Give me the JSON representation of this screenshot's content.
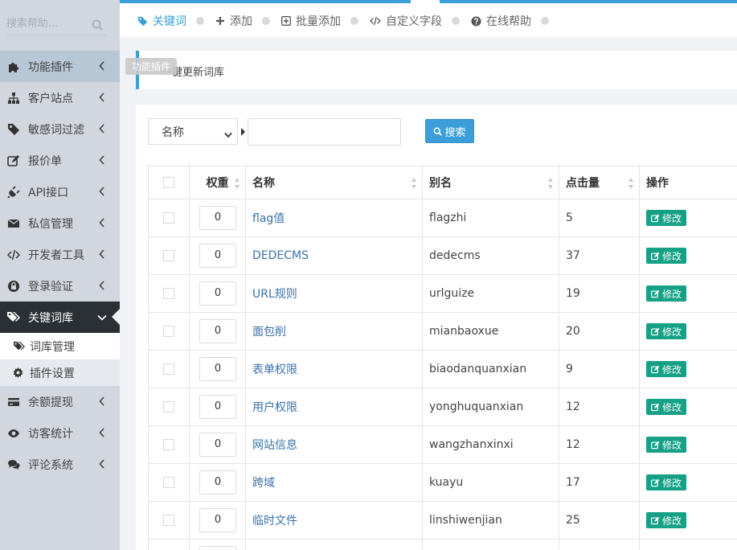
{
  "sidebar": {
    "search_placeholder": "搜索帮助...",
    "items": [
      {
        "label": "功能插件",
        "icon": "puzzle-icon"
      },
      {
        "label": "客户站点",
        "icon": "sitemap-icon"
      },
      {
        "label": "敏感词过滤",
        "icon": "tag-icon"
      },
      {
        "label": "报价单",
        "icon": "edit-icon"
      },
      {
        "label": "API接口",
        "icon": "plug-icon"
      },
      {
        "label": "私信管理",
        "icon": "envelope-icon"
      },
      {
        "label": "开发者工具",
        "icon": "code-icon"
      },
      {
        "label": "登录验证",
        "icon": "lock-icon"
      },
      {
        "label": "关键词库",
        "icon": "tags-icon"
      }
    ],
    "submenu": [
      {
        "label": "词库管理",
        "icon": "tags-icon"
      },
      {
        "label": "插件设置",
        "icon": "gear-icon"
      }
    ],
    "items_after": [
      {
        "label": "余额提现",
        "icon": "credit-card-icon"
      },
      {
        "label": "访客统计",
        "icon": "eye-icon"
      },
      {
        "label": "评论系统",
        "icon": "comments-icon"
      }
    ],
    "tooltip": "功能插件"
  },
  "topbar": {
    "tabs": [
      {
        "label": "关键词",
        "icon": "tag-icon"
      },
      {
        "label": "添加",
        "icon": "plus-icon"
      },
      {
        "label": "批量添加",
        "icon": "plus-square-icon"
      },
      {
        "label": "自定义字段",
        "icon": "code-icon"
      },
      {
        "label": "在线帮助",
        "icon": "question-circle-icon"
      }
    ]
  },
  "notice": {
    "text": "一键更新词库"
  },
  "filter": {
    "select_value": "名称",
    "input_value": "",
    "search_label": "搜索"
  },
  "table": {
    "headers": {
      "weight": "权重",
      "name": "名称",
      "alias": "别名",
      "clicks": "点击量",
      "op": "操作"
    },
    "edit_label": "修改",
    "rows": [
      {
        "weight": "0",
        "name": "flag值",
        "alias": "flagzhi",
        "clicks": "5"
      },
      {
        "weight": "0",
        "name": "DEDECMS",
        "alias": "dedecms",
        "clicks": "37"
      },
      {
        "weight": "0",
        "name": "URL规则",
        "alias": "urlguize",
        "clicks": "19"
      },
      {
        "weight": "0",
        "name": "面包削",
        "alias": "mianbaoxue",
        "clicks": "20"
      },
      {
        "weight": "0",
        "name": "表单权限",
        "alias": "biaodanquanxian",
        "clicks": "9"
      },
      {
        "weight": "0",
        "name": "用户权限",
        "alias": "yonghuquanxian",
        "clicks": "12"
      },
      {
        "weight": "0",
        "name": "网站信息",
        "alias": "wangzhanxinxi",
        "clicks": "12"
      },
      {
        "weight": "0",
        "name": "跨域",
        "alias": "kuayu",
        "clicks": "17"
      },
      {
        "weight": "0",
        "name": "临时文件",
        "alias": "linshiwenjian",
        "clicks": "25"
      },
      {
        "weight": "",
        "name": "",
        "alias": "",
        "clicks": ""
      }
    ]
  },
  "colors": {
    "accent": "#3c9ed9",
    "edit": "#16a085",
    "sidebar_bg": "#d2d6de",
    "active_bg": "#2b3035"
  }
}
